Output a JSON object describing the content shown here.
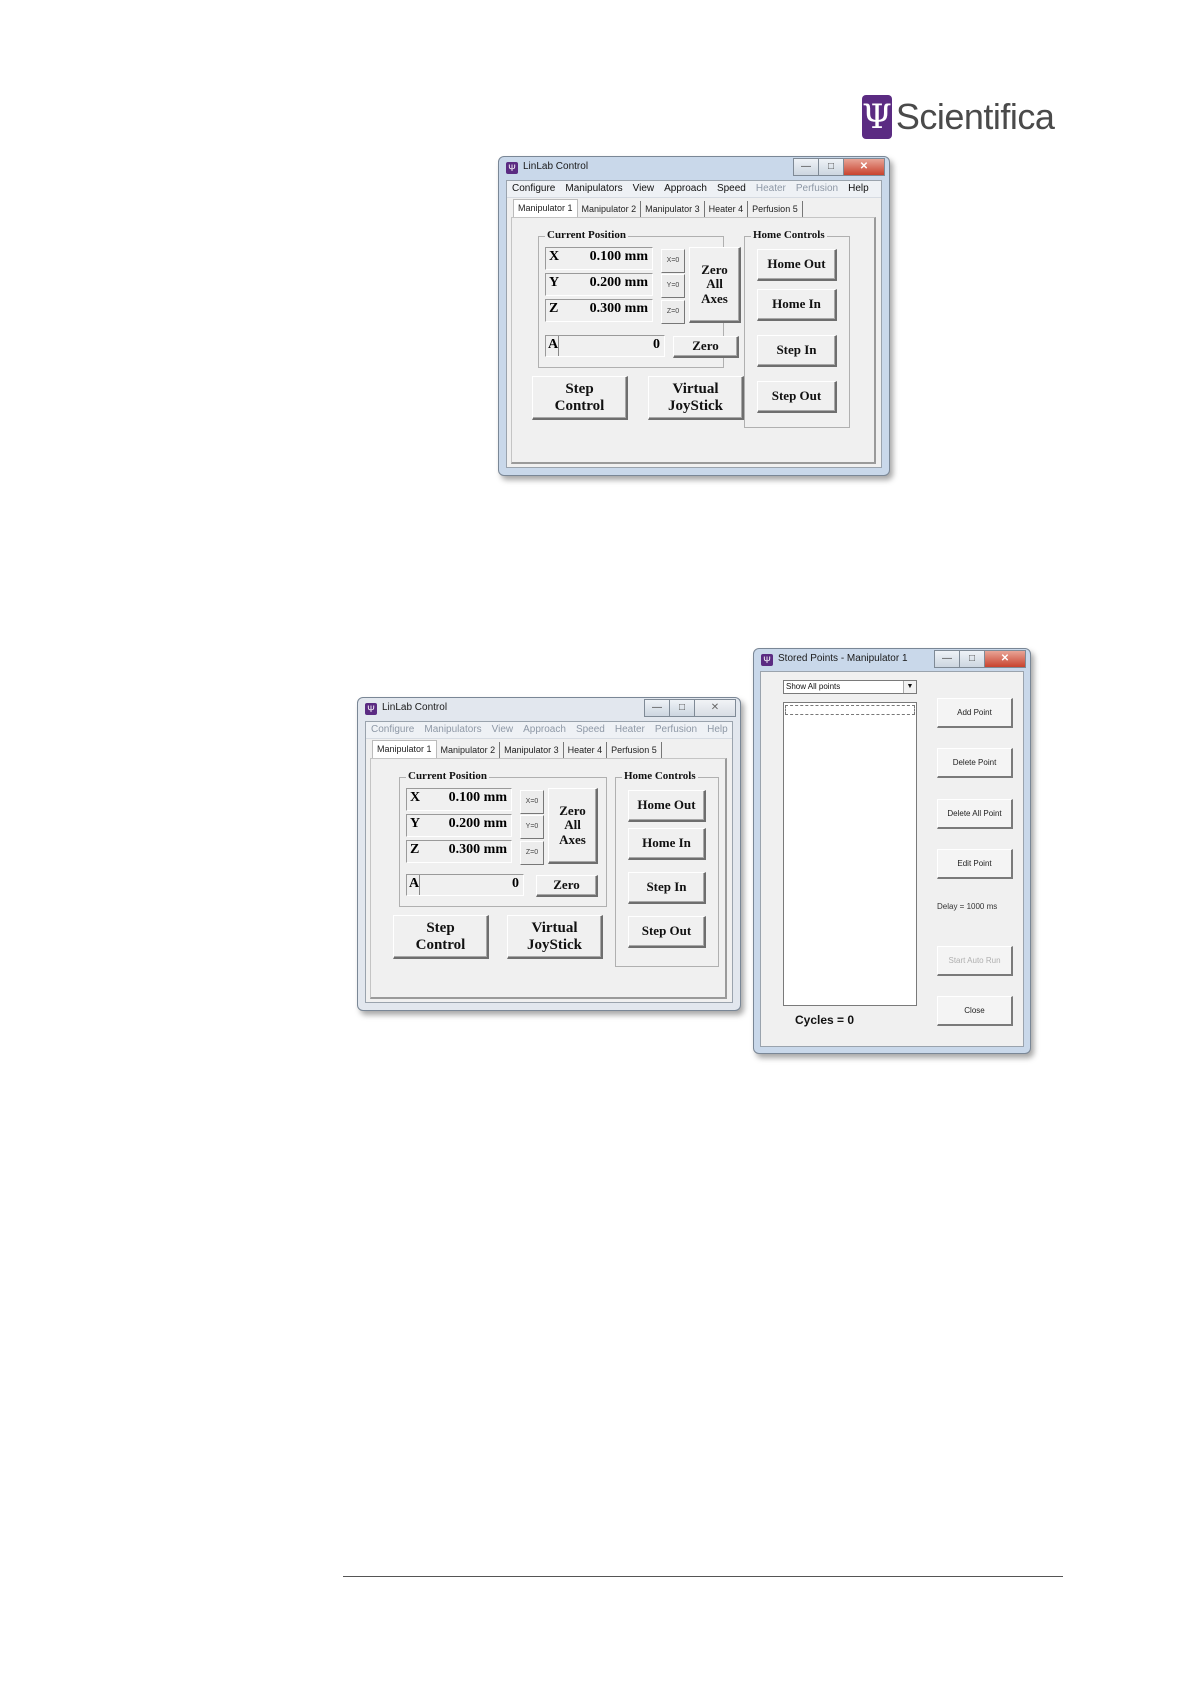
{
  "logo": {
    "mark": "Ψ",
    "text": "Scientifica"
  },
  "window_buttons": {
    "minimize": "—",
    "maximize": "□",
    "close": "✕"
  },
  "linlab": {
    "title": "LinLab Control",
    "menu": [
      "Configure",
      "Manipulators",
      "View",
      "Approach",
      "Speed",
      "Heater",
      "Perfusion",
      "Help"
    ],
    "menu_disabled": [
      "Heater",
      "Perfusion"
    ],
    "tabs": [
      "Manipulator 1",
      "Manipulator 2",
      "Manipulator 3",
      "Heater 4",
      "Perfusion 5"
    ],
    "current_position_title": "Current Position",
    "axes": [
      {
        "letter": "X",
        "value": "0.100 mm",
        "zero": "X=0"
      },
      {
        "letter": "Y",
        "value": "0.200 mm",
        "zero": "Y=0"
      },
      {
        "letter": "Z",
        "value": "0.300 mm",
        "zero": "Z=0"
      }
    ],
    "zero_all": [
      "Zero",
      "All",
      "Axes"
    ],
    "a_axis": {
      "letter": "A",
      "value": "0",
      "zero": "Zero"
    },
    "step_control": [
      "Step",
      "Control"
    ],
    "virtual_joystick": [
      "Virtual",
      "JoyStick"
    ],
    "home_controls_title": "Home Controls",
    "home_buttons": [
      "Home Out",
      "Home In",
      "Step In",
      "Step Out"
    ]
  },
  "stored_points": {
    "title": "Stored Points - Manipulator 1",
    "filter": "Show All points",
    "buttons": {
      "add": "Add Point",
      "delete": "Delete Point",
      "delete_all": "Delete All Point",
      "edit": "Edit Point",
      "start_auto_run": "Start Auto Run",
      "close": "Close"
    },
    "delay": "Delay = 1000 ms",
    "cycles": "Cycles = 0"
  }
}
